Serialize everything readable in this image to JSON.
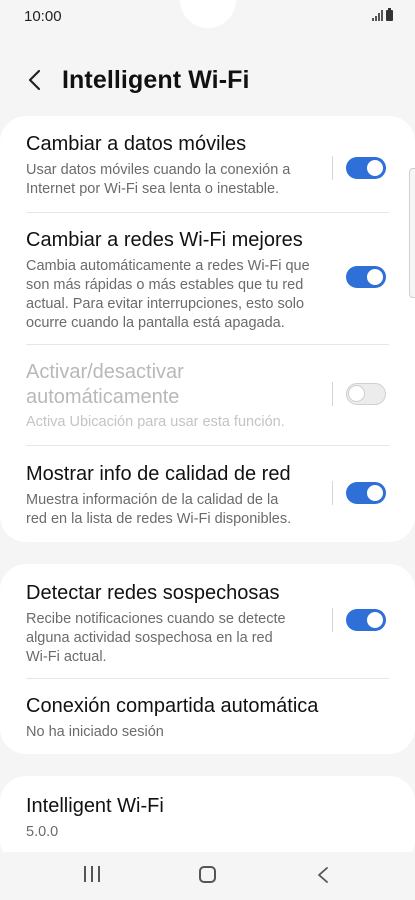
{
  "status": {
    "time": "10:00"
  },
  "header": {
    "title": "Intelligent Wi-Fi",
    "back_icon": "chevron-left-icon"
  },
  "settings": [
    {
      "title": "Cambiar a datos móviles",
      "subtitle_lines": [
        "Usar datos móviles cuando la conexión a",
        "Internet por Wi-Fi sea lenta o inestable."
      ],
      "toggle": true,
      "enabled": true
    },
    {
      "title": "Cambiar a redes Wi-Fi mejores",
      "subtitle_lines": [
        "Cambia automáticamente a redes Wi-Fi que",
        "son más rápidas o más estables que tu red",
        "actual. Para evitar interrupciones, esto solo",
        "ocurre cuando la pantalla está apagada."
      ],
      "toggle": true,
      "enabled": true
    },
    {
      "title_lines": [
        "Activar/desactivar",
        "automáticamente"
      ],
      "subtitle_lines": [
        "Activa Ubicación para usar esta función."
      ],
      "toggle": false,
      "enabled": false
    },
    {
      "title": "Mostrar info de calidad de red",
      "subtitle_lines": [
        "Muestra información de la calidad de la",
        "red en la lista de redes Wi-Fi disponibles."
      ],
      "toggle": true,
      "enabled": true
    },
    {
      "title": "Detectar redes sospechosas",
      "subtitle_lines": [
        "Recibe notificaciones cuando se detecte",
        "alguna actividad sospechosa en la red",
        "Wi-Fi actual."
      ],
      "toggle": true,
      "enabled": true
    },
    {
      "title": "Conexión compartida automática",
      "subtitle_lines": [
        "No ha iniciado sesión"
      ]
    }
  ],
  "about": {
    "title": "Intelligent Wi-Fi",
    "version": "5.0.0"
  },
  "colors": {
    "accent": "#2f6fd8",
    "background": "#f5f5f5",
    "card": "#ffffff",
    "subtitle": "#6b6b6b"
  },
  "navbar": {
    "icons": [
      "recents-icon",
      "home-icon",
      "back-icon"
    ]
  }
}
